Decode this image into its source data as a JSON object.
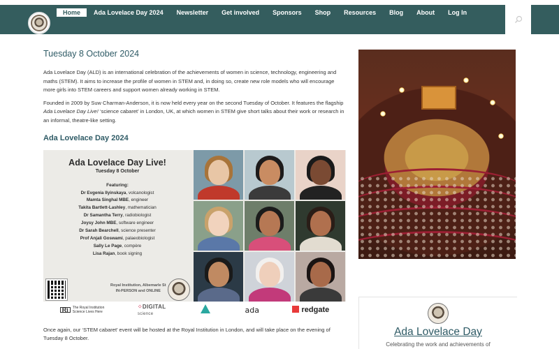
{
  "nav": {
    "items": [
      {
        "label": "Home",
        "active": true
      },
      {
        "label": "Ada Lovelace Day 2024",
        "active": false
      },
      {
        "label": "Newsletter",
        "active": false
      },
      {
        "label": "Get involved",
        "active": false
      },
      {
        "label": "Sponsors",
        "active": false
      },
      {
        "label": "Shop",
        "active": false
      },
      {
        "label": "Resources",
        "active": false
      },
      {
        "label": "Blog",
        "active": false
      },
      {
        "label": "About",
        "active": false
      },
      {
        "label": "Log In",
        "active": false
      }
    ],
    "search_icon": "search-icon"
  },
  "colors": {
    "nav_bg": "#345d5e",
    "heading": "#2f5b66",
    "accent_red": "#9b1f33"
  },
  "post": {
    "title": "Tuesday 8 October 2024",
    "para1": "Ada Lovelace Day (ALD) is an international celebration of the achievements of women in science, technology, engineering and maths (STEM). It aims to increase the profile of women in STEM and, in doing so, create new role models who will encourage more girls into STEM careers and support women already working in STEM.",
    "para2_before": "Founded in 2009 by Suw Charman-Anderson, it is now held every year on the second Tuesday of October. It features the flagship ",
    "para2_em": "Ada Lovelace Day Live!",
    "para2_after": " ‘science cabaret’ in London, UK, at which women in STEM give short talks about their work or research in an informal, theatre-like setting.",
    "section_title": "Ada Lovelace Day 2024",
    "para3": "Once again, our ‘STEM cabaret’ event will be hosted at the Royal Institution in London, and will take place on the evening of Tuesday 8 October."
  },
  "banner": {
    "title": "Ada Lovelace Day Live!",
    "date": "Tuesday 8 October",
    "featuring": "Featuring:",
    "speakers": [
      {
        "name": "Dr Evgenia Ilyinskaya",
        "role": ", volcanologist"
      },
      {
        "name": "Mamta Singhal MBE",
        "role": ", engineer"
      },
      {
        "name": "Takita Bartlett-Lashley",
        "role": ", mathematician"
      },
      {
        "name": "Dr Samantha Terry",
        "role": ", radiobiologist"
      },
      {
        "name": "Joysy John MBE",
        "role": ", software engineer"
      },
      {
        "name": "Dr Sarah Bearchell",
        "role": ", science presenter"
      },
      {
        "name": "Prof Anjali Goswami",
        "role": ", palaeobiologist"
      },
      {
        "name": "Sally Le Page",
        "role": ", compère"
      },
      {
        "name": "Lisa Rajan",
        "role": ", book signing"
      }
    ],
    "venue_line1": "Royal Institution, Albemarle St",
    "venue_line2": "IN-PERSON and ONLINE",
    "sponsors": {
      "ri_mark": "Ri",
      "ri_line1": "The Royal Institution",
      "ri_line2": "Science Lives Here",
      "digital": "DIGITAL",
      "digital_sub": "science",
      "ada": "ada",
      "redgate": "redgate"
    }
  },
  "sidebar": {
    "widget_title": "Ada Lovelace Day",
    "widget_tagline": "Celebrating the work and achievements of"
  }
}
